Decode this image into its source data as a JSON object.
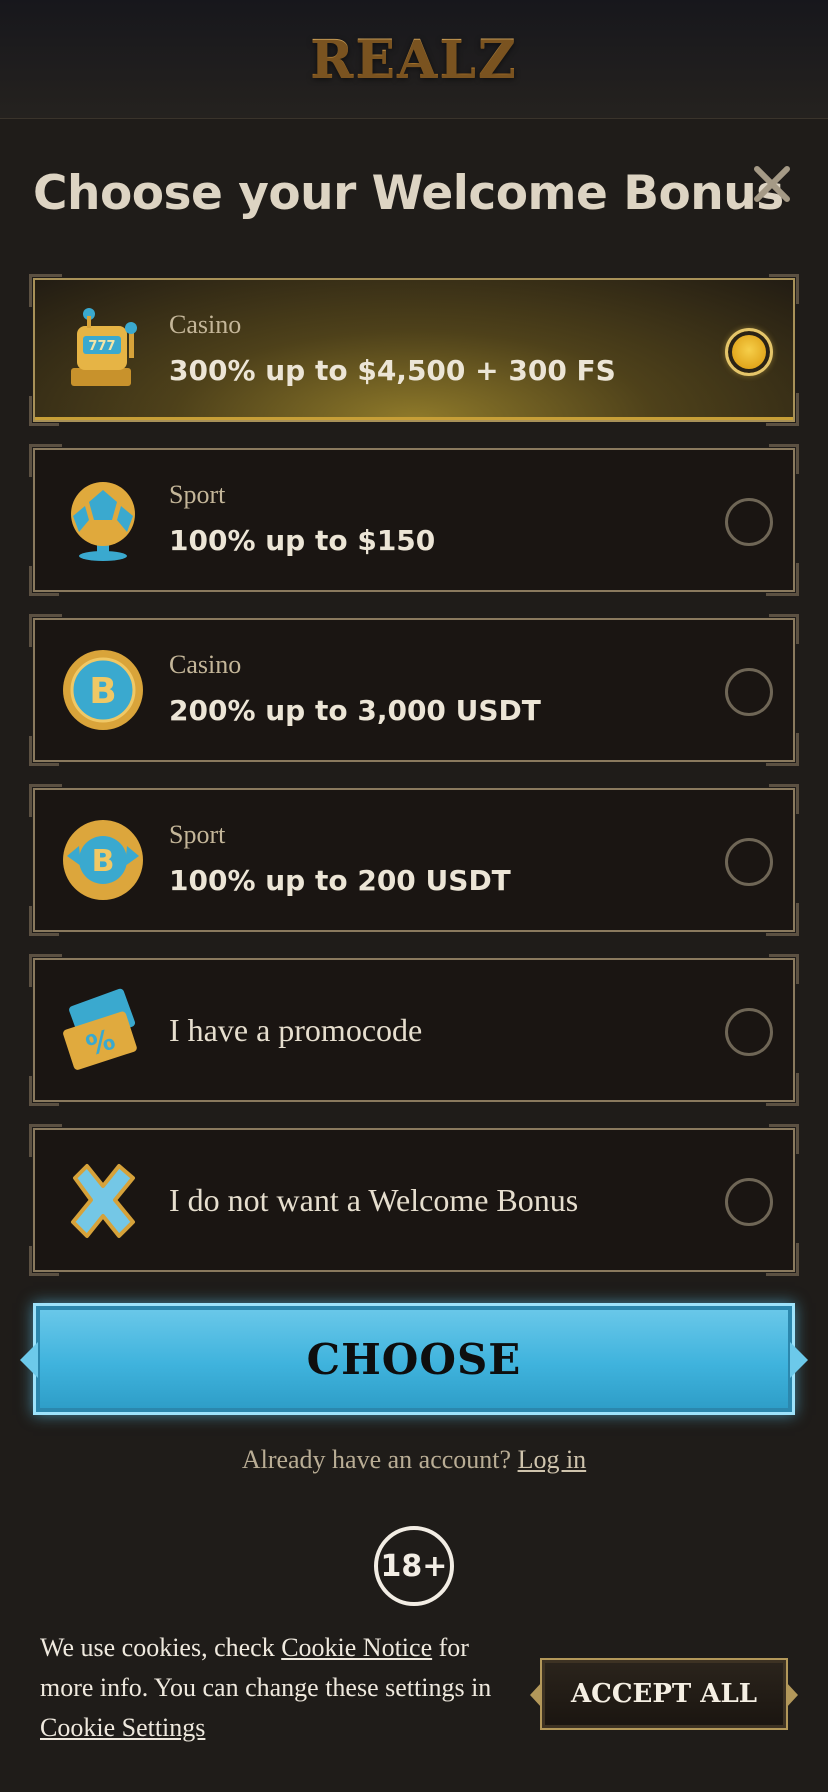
{
  "header": {
    "logo": "REALZ"
  },
  "modal": {
    "title": "Choose your Welcome Bonus",
    "close_icon": "close-icon"
  },
  "options": [
    {
      "category": "Casino",
      "offer": "300% up to $4,500 + 300 FS",
      "icon": "slot-machine-icon",
      "selected": true
    },
    {
      "category": "Sport",
      "offer": "100% up to $150",
      "icon": "football-trophy-icon",
      "selected": false
    },
    {
      "category": "Casino",
      "offer": "200% up to 3,000 USDT",
      "icon": "bitcoin-coin-icon",
      "selected": false
    },
    {
      "category": "Sport",
      "offer": "100% up to 200 USDT",
      "icon": "bitcoin-football-icon",
      "selected": false
    },
    {
      "label": "I have a promocode",
      "icon": "promo-ticket-icon",
      "selected": false
    },
    {
      "label": "I do not want a Welcome Bonus",
      "icon": "cross-icon",
      "selected": false
    }
  ],
  "choose_button": "CHOOSE",
  "login": {
    "prompt": "Already have an account?",
    "link": "Log in"
  },
  "age_badge": "18+",
  "cookie": {
    "text_1": "We use cookies, check ",
    "link_1": "Cookie Notice",
    "text_2": " for more info. You can change these settings in ",
    "link_2": "Cookie Settings",
    "accept": "ACCEPT ALL"
  },
  "colors": {
    "background": "#1f1c19",
    "gold_accent": "#e1a51b",
    "button_blue": "#3fb3dd"
  }
}
